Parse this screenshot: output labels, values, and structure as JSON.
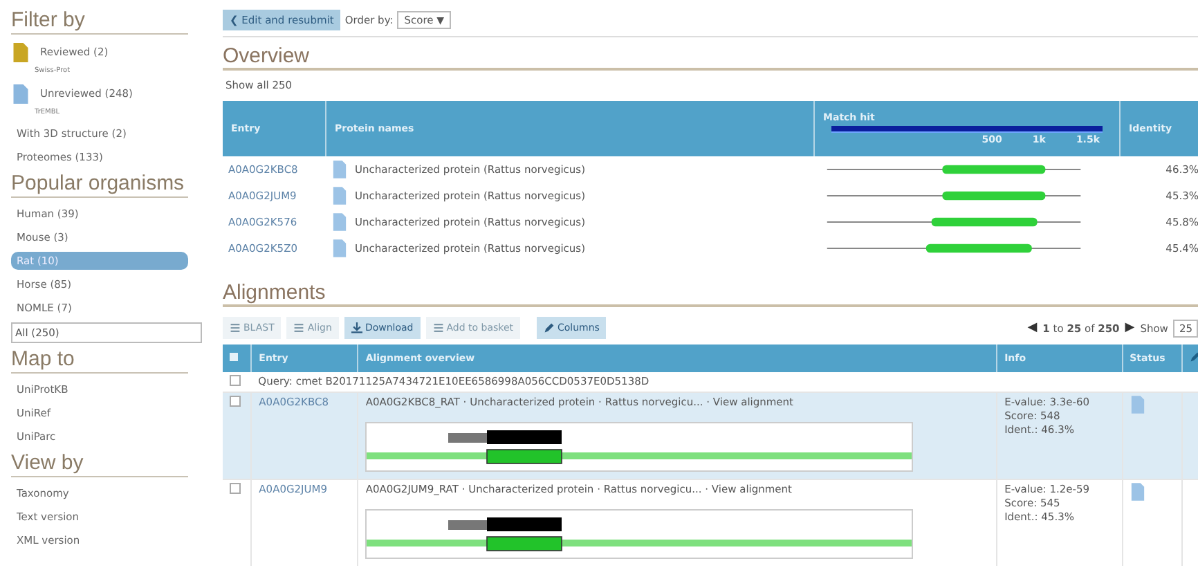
{
  "sidebar": {
    "sections": [
      {
        "title": "Filter by",
        "items": [
          {
            "label": "Reviewed (2)",
            "sub": "Swiss-Prot",
            "kind": "reviewed",
            "selected": false
          },
          {
            "label": "Unreviewed (248)",
            "sub": "TrEMBL",
            "kind": "unreviewed",
            "selected": false
          },
          {
            "label": "With 3D structure (2)",
            "kind": "plain",
            "selected": false
          },
          {
            "label": "Proteomes (133)",
            "kind": "plain",
            "selected": false
          }
        ]
      },
      {
        "title": "Popular organisms",
        "items": [
          {
            "label": "Human (39)",
            "kind": "plain",
            "selected": false
          },
          {
            "label": "Mouse (3)",
            "kind": "plain",
            "selected": false
          },
          {
            "label": "Rat (10)",
            "kind": "plain",
            "selected": true
          },
          {
            "label": "Horse (85)",
            "kind": "plain",
            "selected": false
          },
          {
            "label": "NOMLE (7)",
            "kind": "plain",
            "selected": false
          },
          {
            "label": "All (250)",
            "kind": "select",
            "selected": false
          }
        ]
      },
      {
        "title": "Map to",
        "items": [
          {
            "label": "UniProtKB",
            "kind": "plain",
            "selected": false
          },
          {
            "label": "UniRef",
            "kind": "plain",
            "selected": false
          },
          {
            "label": "UniParc",
            "kind": "plain",
            "selected": false
          }
        ]
      },
      {
        "title": "View by",
        "items": [
          {
            "label": "Taxonomy",
            "kind": "plain",
            "selected": false
          },
          {
            "label": "Text version",
            "kind": "plain",
            "selected": false
          },
          {
            "label": "XML version",
            "kind": "plain",
            "selected": false
          }
        ]
      }
    ]
  },
  "topbar": {
    "back_button": "Edit and resubmit",
    "back_arrow": "❮",
    "order_label": "Order by:",
    "order_value": "Score",
    "order_caret": "▼"
  },
  "overview": {
    "title": "Overview",
    "show_all": "Show all 250",
    "columns": [
      "Entry",
      "Protein names",
      "Match hit",
      "Identity"
    ],
    "scale_labels": [
      "500",
      "1k",
      "1.5k"
    ],
    "rows": [
      {
        "entry": "A0A0G2KBC8",
        "name": "Uncharacterized protein (Rattus norvegicus)",
        "identity": "46.3%"
      },
      {
        "entry": "A0A0G2JUM9",
        "name": "Uncharacterized protein (Rattus norvegicus)",
        "identity": "45.3%"
      },
      {
        "entry": "A0A0G2K576",
        "name": "Uncharacterized protein (Rattus norvegicus)",
        "identity": "45.8%"
      },
      {
        "entry": "A0A0G2K5Z0",
        "name": "Uncharacterized protein (Rattus norvegicus)",
        "identity": "45.4%"
      }
    ]
  },
  "alignments": {
    "title": "Alignments",
    "toolbar": [
      {
        "label": "BLAST",
        "kind": "blast",
        "disabled": true
      },
      {
        "label": "Align",
        "kind": "align",
        "disabled": true
      },
      {
        "label": "Download",
        "kind": "download",
        "disabled": false
      },
      {
        "label": "Add to basket",
        "kind": "basket",
        "disabled": true
      },
      {
        "label": "Columns",
        "kind": "columns",
        "disabled": false
      }
    ],
    "pagination": {
      "prev": "◀",
      "text": "**1** to **25** of **250**",
      "next": "▶",
      "show_label": "Show",
      "show_value": "25"
    },
    "columns": [
      "Entry",
      "Alignment overview",
      "Info",
      "Status"
    ],
    "select_all_checked": false,
    "query_checked": false,
    "query": "Query: cmet B20171125A7434721E10EE6586998A056CCD0537E0D5138D",
    "rows": [
      {
        "entry": "A0A0G2KBC8",
        "description": "A0A0G2KBC8_RAT · Uncharacterized protein · Rattus norvegicu... ·",
        "link": "View alignment",
        "info": [
          "E-value: 3.3e-60",
          "Score: 548",
          "Ident.: 46.3%"
        ],
        "selected": true,
        "checked": false
      },
      {
        "entry": "A0A0G2JUM9",
        "description": "A0A0G2JUM9_RAT · Uncharacterized protein · Rattus norvegicu... ·",
        "link": "View alignment",
        "info": [
          "E-value: 1.2e-59",
          "Score: 545",
          "Ident.: 45.3%"
        ],
        "selected": false,
        "checked": false
      }
    ]
  }
}
